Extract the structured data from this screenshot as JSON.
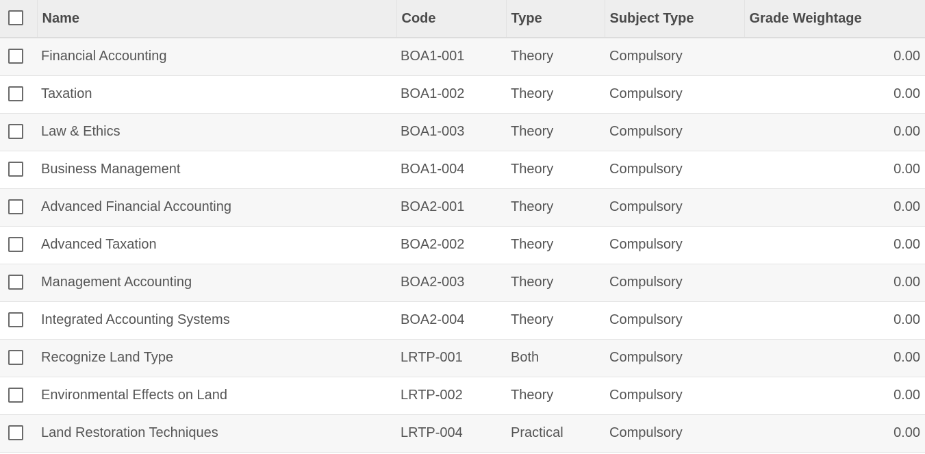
{
  "table": {
    "headers": {
      "name": "Name",
      "code": "Code",
      "type": "Type",
      "subject_type": "Subject Type",
      "grade_weightage": "Grade Weightage"
    },
    "rows": [
      {
        "name": "Financial Accounting",
        "code": "BOA1-001",
        "type": "Theory",
        "subject_type": "Compulsory",
        "grade_weightage": "0.00"
      },
      {
        "name": "Taxation",
        "code": "BOA1-002",
        "type": "Theory",
        "subject_type": "Compulsory",
        "grade_weightage": "0.00"
      },
      {
        "name": "Law & Ethics",
        "code": "BOA1-003",
        "type": "Theory",
        "subject_type": "Compulsory",
        "grade_weightage": "0.00"
      },
      {
        "name": "Business Management",
        "code": "BOA1-004",
        "type": "Theory",
        "subject_type": "Compulsory",
        "grade_weightage": "0.00"
      },
      {
        "name": "Advanced Financial Accounting",
        "code": "BOA2-001",
        "type": "Theory",
        "subject_type": "Compulsory",
        "grade_weightage": "0.00"
      },
      {
        "name": "Advanced Taxation",
        "code": "BOA2-002",
        "type": "Theory",
        "subject_type": "Compulsory",
        "grade_weightage": "0.00"
      },
      {
        "name": "Management Accounting",
        "code": "BOA2-003",
        "type": "Theory",
        "subject_type": "Compulsory",
        "grade_weightage": "0.00"
      },
      {
        "name": "Integrated Accounting Systems",
        "code": "BOA2-004",
        "type": "Theory",
        "subject_type": "Compulsory",
        "grade_weightage": "0.00"
      },
      {
        "name": "Recognize Land Type",
        "code": "LRTP-001",
        "type": "Both",
        "subject_type": "Compulsory",
        "grade_weightage": "0.00"
      },
      {
        "name": "Environmental Effects on Land",
        "code": "LRTP-002",
        "type": "Theory",
        "subject_type": "Compulsory",
        "grade_weightage": "0.00"
      },
      {
        "name": "Land Restoration Techniques",
        "code": "LRTP-004",
        "type": "Practical",
        "subject_type": "Compulsory",
        "grade_weightage": "0.00"
      }
    ]
  }
}
